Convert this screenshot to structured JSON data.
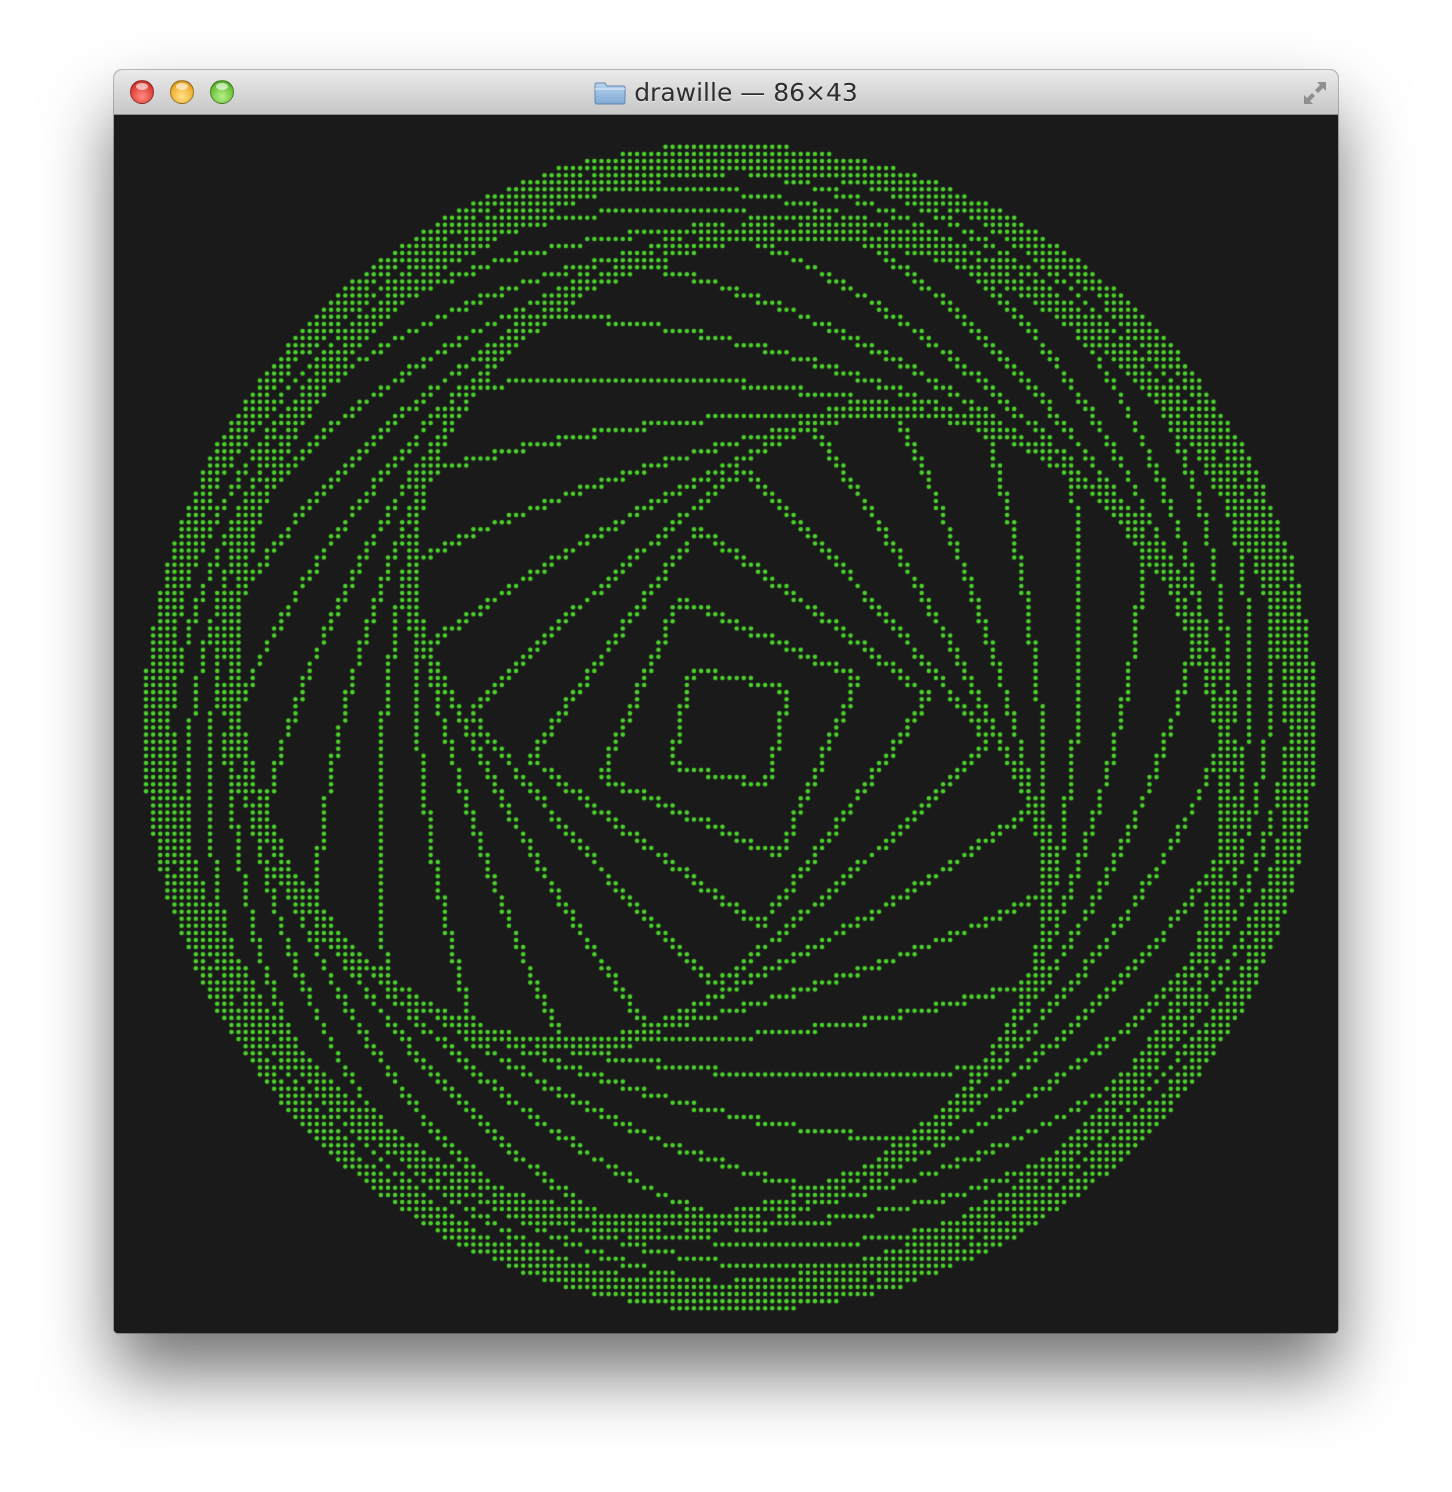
{
  "window": {
    "title": "drawille — 86×43",
    "folder_icon": "folder-icon",
    "fullscreen_icon": "fullscreen-icon"
  },
  "traffic_lights": {
    "close_color": "#e0443a",
    "minimize_color": "#f0b030",
    "zoom_color": "#6cc53a"
  },
  "terminal": {
    "background": "#1a1a1a",
    "foreground": "#4bd22b",
    "columns": 86,
    "rows": 43,
    "pattern": "rotating-square-sphere"
  }
}
